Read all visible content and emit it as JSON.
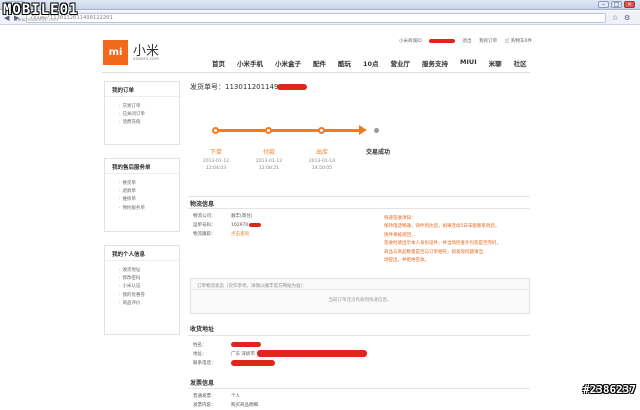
{
  "browser": {
    "tab_title": "订单详情",
    "url": "/View/1130112011490122201",
    "watermark": "MOBILE01",
    "watermark_sub": "www.mobile01.com"
  },
  "topnav": {
    "user_prefix": "小米商城ID",
    "logout": "退出",
    "my_orders": "我的订单",
    "cart": "购物车0件"
  },
  "logo": {
    "mark": "mi",
    "cn": "小米",
    "en": "xiaomi.com"
  },
  "mainnav": [
    "首页",
    "小米手机",
    "小米盒子",
    "配件",
    "酷玩",
    "10点",
    "营业厅",
    "服务支持",
    "MIUI",
    "米聊",
    "社区"
  ],
  "sidebar": [
    {
      "title": "我的订单",
      "items": [
        "交易订单",
        "已关闭订单",
        "话费充值"
      ]
    },
    {
      "title": "我的售后服务单",
      "items": [
        "换货单",
        "退款单",
        "维修单",
        "预约服务单"
      ]
    },
    {
      "title": "我的个人信息",
      "items": [
        "收货地址",
        "修改密码",
        "小米认证",
        "我的优惠券",
        "商品评价"
      ]
    }
  ],
  "order": {
    "label": "发货单号：",
    "number": "113011201149"
  },
  "steps": [
    {
      "label": "下单",
      "date": "2013-01-12",
      "time": "12:04:03"
    },
    {
      "label": "付款",
      "date": "2013-01-12",
      "time": "12:08:21"
    },
    {
      "label": "出库",
      "date": "2013-01-14",
      "time": "14:50:05"
    }
  ],
  "final_step": "交易成功",
  "logistics": {
    "title": "物流信息",
    "company_k": "物流公司：",
    "company_v": "顺丰(寄付)",
    "bill_k": "运单号码：",
    "bill_v": "102970",
    "track_k": "物流跟踪：",
    "track_v": "点击查询",
    "notice_title": "快递签收须知：",
    "notice_lines": [
      "保持电话畅通，快件到达后，如果连续5日未能联系到您，",
      "快件将被退回；",
      "签收时请出示本人身份证件，并当场检查外包装是否完好，",
      "商品与商品数量是否与订单相符，如发现问题请当",
      "场提出，并拒绝签收。"
    ]
  },
  "tracking": {
    "head": "订单物流状态（仅作参考，详情以顺丰官方网站为准）：",
    "empty": "当前订单还没有收到快递信息。"
  },
  "address": {
    "title": "收货地址",
    "name_k": "姓名：",
    "addr_k": "地址：",
    "addr_v": "广东 深圳市",
    "phone_k": "联系电话："
  },
  "invoice": {
    "title": "发票信息",
    "type_k": "普通发票：",
    "type_v": "个人",
    "content_k": "发票内容：",
    "content_v": "购买商品明细"
  },
  "photo_id": "#2386237"
}
